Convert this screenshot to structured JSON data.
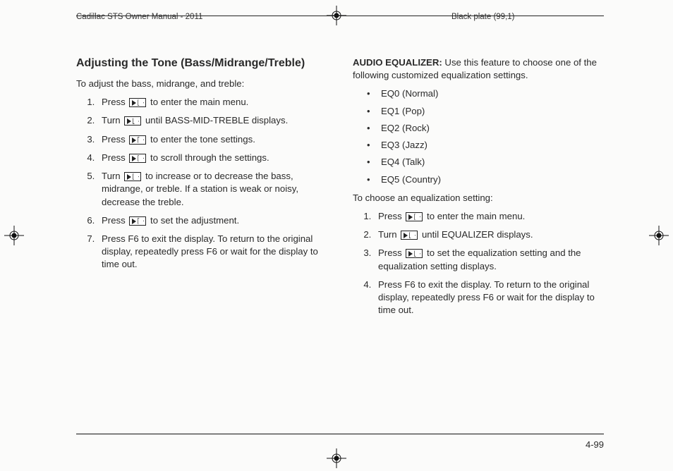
{
  "header": {
    "left": "Cadillac STS Owner Manual - 2011",
    "right": "Black plate (99,1)"
  },
  "left_col": {
    "heading": "Adjusting the Tone (Bass/Midrange/Treble)",
    "intro": "To adjust the bass, midrange, and treble:",
    "steps": [
      {
        "pre": "Press ",
        "icon": true,
        "post": " to enter the main menu."
      },
      {
        "pre": "Turn ",
        "icon": true,
        "post": " until BASS-MID-TREBLE displays."
      },
      {
        "pre": "Press ",
        "icon": true,
        "post": " to enter the tone settings."
      },
      {
        "pre": "Press ",
        "icon": true,
        "post": " to scroll through the settings."
      },
      {
        "pre": "Turn ",
        "icon": true,
        "post": " to increase or to decrease the bass, midrange, or treble. If a station is weak or noisy, decrease the treble."
      },
      {
        "pre": "Press ",
        "icon": true,
        "post": " to set the adjustment."
      },
      {
        "pre": "Press F6 to exit the display. To return to the original display, repeatedly press F6 or wait for the display to time out.",
        "icon": false,
        "post": ""
      }
    ]
  },
  "right_col": {
    "lead_strong": "AUDIO EQUALIZER:",
    "lead_rest": " Use this feature to choose one of the following customized equalization settings.",
    "bullets": [
      "EQ0 (Normal)",
      "EQ1 (Pop)",
      "EQ2 (Rock)",
      "EQ3 (Jazz)",
      "EQ4 (Talk)",
      "EQ5 (Country)"
    ],
    "intro2": "To choose an equalization setting:",
    "steps": [
      {
        "pre": "Press ",
        "icon": true,
        "post": " to enter the main menu."
      },
      {
        "pre": "Turn ",
        "icon": true,
        "post": " until EQUALIZER displays."
      },
      {
        "pre": "Press ",
        "icon": true,
        "post": " to set the equalization setting and the equalization setting displays."
      },
      {
        "pre": "Press F6 to exit the display. To return to the original display, repeatedly press F6 or wait for the display to time out.",
        "icon": false,
        "post": ""
      }
    ]
  },
  "footer": {
    "page_num": "4-99"
  }
}
